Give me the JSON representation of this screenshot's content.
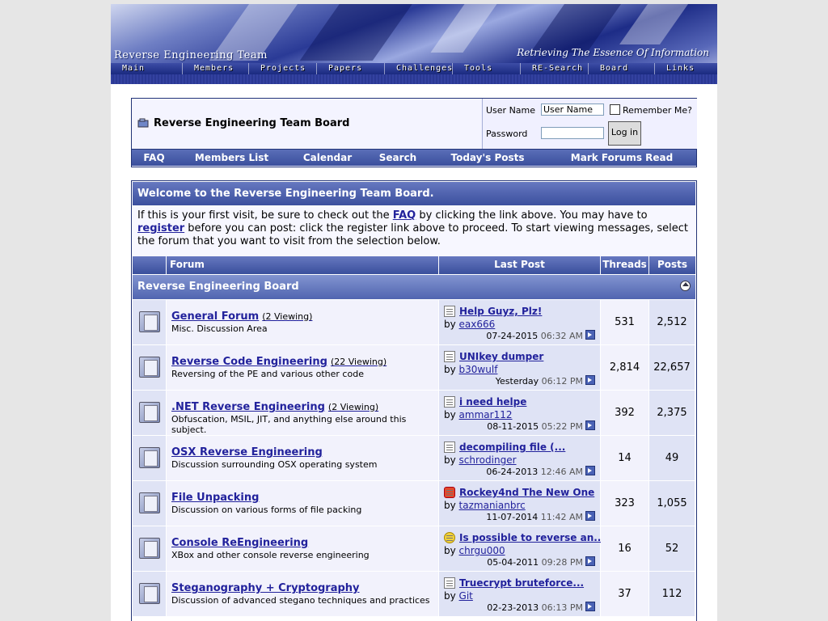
{
  "header": {
    "title": "Reverse Engineering Team",
    "tagline": "Retrieving The Essence Of Information",
    "nav": [
      "Main",
      "Members",
      "Projects",
      "Papers",
      "Challenges",
      "Tools",
      "RE-Search",
      "Board",
      "Links"
    ]
  },
  "navbox": {
    "board_title": "Reverse Engineering Team Board",
    "login": {
      "username_label": "User Name",
      "username_value": "User Name",
      "remember_label": "Remember Me?",
      "password_label": "Password",
      "login_button": "Log in"
    },
    "links": [
      "FAQ",
      "Members List",
      "Calendar",
      "Search",
      "Today's Posts",
      "Mark Forums Read"
    ]
  },
  "welcome": {
    "title": "Welcome to the Reverse Engineering Team Board.",
    "text_1": "If this is your first visit, be sure to check out the ",
    "faq_link": "FAQ",
    "text_2": " by clicking the link above. You may have to ",
    "register_link": "register",
    "text_3": " before you can post: click the register link above to proceed. To start viewing messages, select the forum that you want to visit from the selection below."
  },
  "columns": {
    "forum": "Forum",
    "last_post": "Last Post",
    "threads": "Threads",
    "posts": "Posts"
  },
  "category": "Reverse Engineering Board",
  "forums": [
    {
      "name": "General Forum",
      "viewing": "(2 Viewing)",
      "desc": "Misc. Discussion Area",
      "last_title": "Help Guyz, Plz!",
      "last_icon": "page",
      "by": "by",
      "user": "eax666",
      "date": "07-24-2015",
      "time": "06:32 AM",
      "threads": "531",
      "posts": "2,512"
    },
    {
      "name": "Reverse Code Engineering",
      "viewing": "(22 Viewing)",
      "desc": "Reversing of the PE and various other code",
      "last_title": "UNIkey dumper",
      "last_icon": "page",
      "by": "by",
      "user": "b30wulf",
      "date": "Yesterday",
      "time": "06:12 PM",
      "threads": "2,814",
      "posts": "22,657"
    },
    {
      "name": ".NET Reverse Engineering",
      "viewing": "(2 Viewing)",
      "desc": "Obfuscation, MSIL, JIT, and anything else around this subject.",
      "last_title": "i need helpe",
      "last_icon": "page",
      "by": "by",
      "user": "ammar112",
      "date": "08-11-2015",
      "time": "05:22 PM",
      "threads": "392",
      "posts": "2,375"
    },
    {
      "name": "OSX Reverse Engineering",
      "viewing": "",
      "desc": "Discussion surrounding OSX operating system",
      "last_title": "decompiling file (...",
      "last_icon": "page",
      "by": "by",
      "user": "schrodinger",
      "date": "06-24-2013",
      "time": "12:46 AM",
      "threads": "14",
      "posts": "49"
    },
    {
      "name": "File Unpacking",
      "viewing": "",
      "desc": "Discussion on various forms of file packing",
      "last_title": "Rockey4nd The New One",
      "last_icon": "thumb",
      "by": "by",
      "user": "tazmanianbrc",
      "date": "11-07-2014",
      "time": "11:42 AM",
      "threads": "323",
      "posts": "1,055"
    },
    {
      "name": "Console ReEngineering",
      "viewing": "",
      "desc": "XBox and other console reverse engineering",
      "last_title": "Is possible to reverse an...",
      "last_icon": "cool",
      "by": "by",
      "user": "chrgu000",
      "date": "05-04-2011",
      "time": "09:28 PM",
      "threads": "16",
      "posts": "52"
    },
    {
      "name": "Steganography + Cryptography",
      "viewing": "",
      "desc": "Discussion of advanced stegano techniques and practices",
      "last_title": "Truecrypt bruteforce...",
      "last_icon": "page",
      "by": "by",
      "user": "Git",
      "date": "02-23-2013",
      "time": "06:13 PM",
      "threads": "37",
      "posts": "112"
    }
  ]
}
